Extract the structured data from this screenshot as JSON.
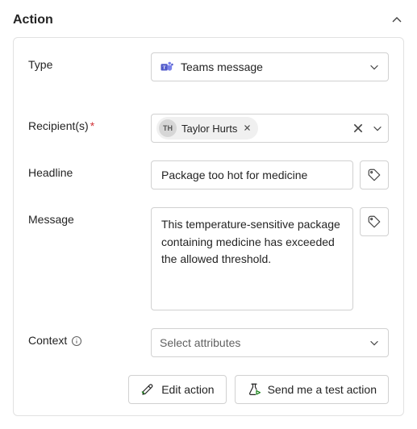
{
  "header": {
    "title": "Action"
  },
  "labels": {
    "type": "Type",
    "recipients": "Recipient(s)",
    "headline": "Headline",
    "message": "Message",
    "context": "Context"
  },
  "type": {
    "selected": "Teams message"
  },
  "recipients": {
    "required": "*",
    "chip": {
      "initials": "TH",
      "name": "Taylor Hurts"
    }
  },
  "headline": {
    "value": "Package too hot for medicine"
  },
  "message": {
    "value": "This temperature-sensitive package containing medicine has exceeded the allowed threshold."
  },
  "context": {
    "placeholder": "Select attributes"
  },
  "buttons": {
    "edit": "Edit action",
    "test": "Send me a test action"
  }
}
